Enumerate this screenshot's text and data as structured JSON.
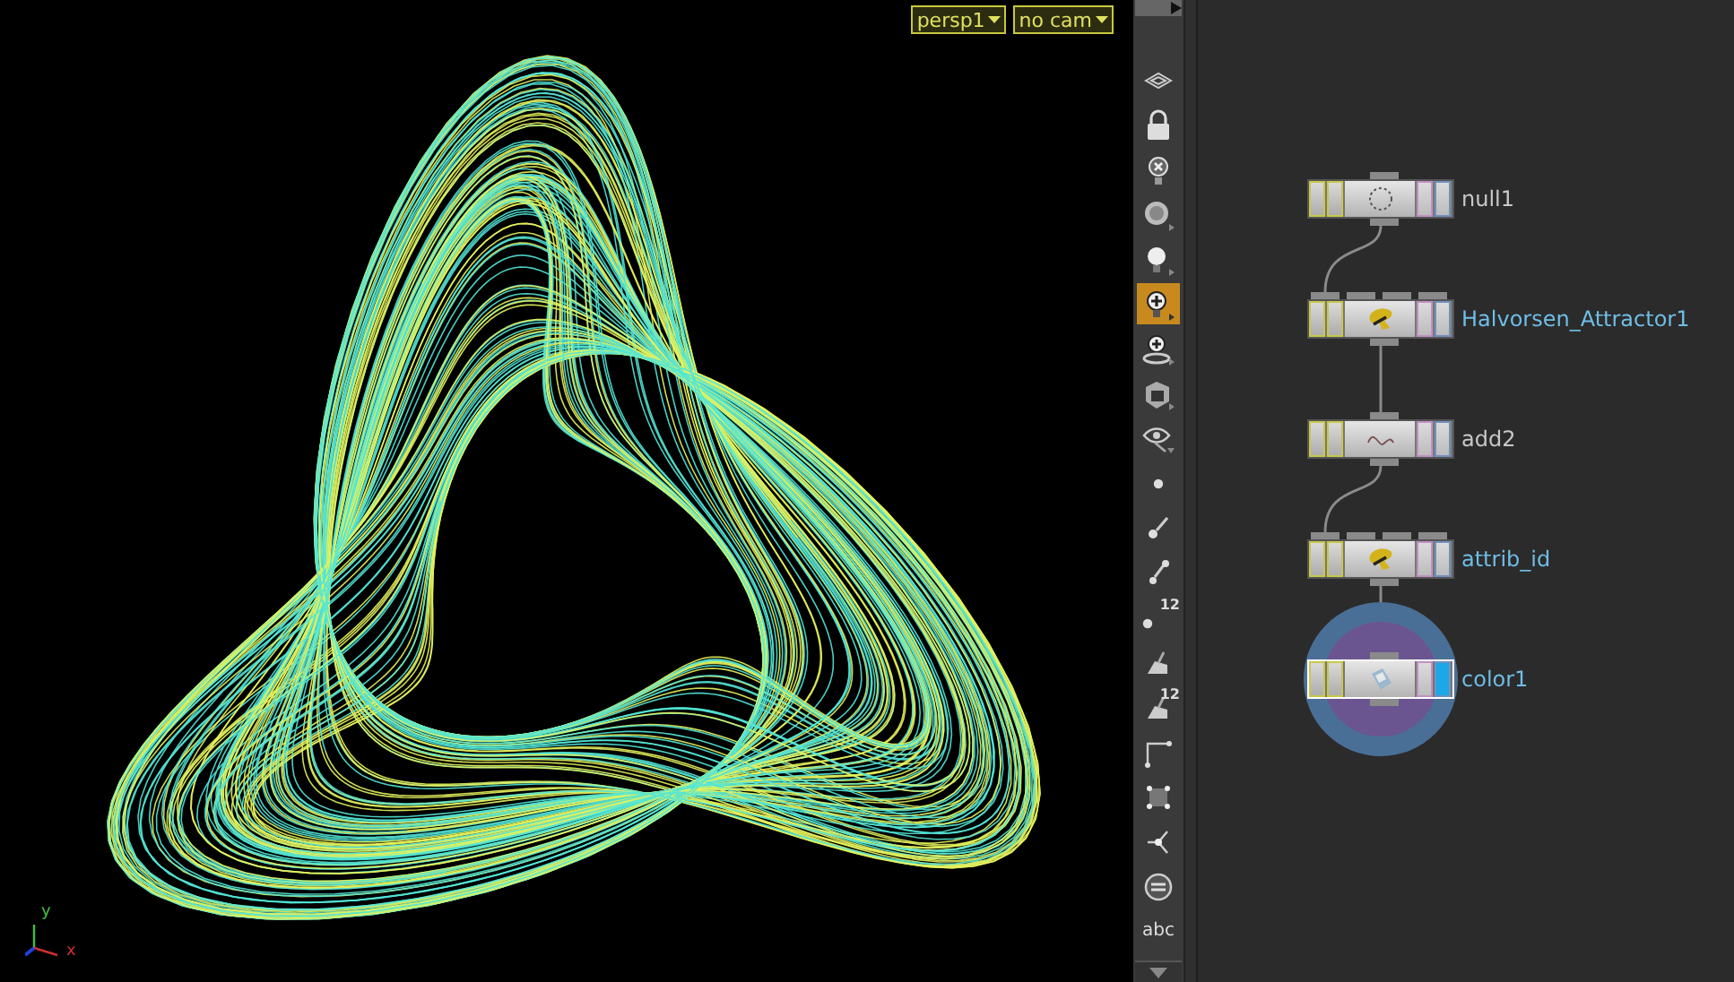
{
  "viewport": {
    "camera_menus": [
      {
        "label": "persp1"
      },
      {
        "label": "no cam"
      }
    ],
    "axis_labels": [
      {
        "label": "y"
      },
      {
        "label": "x"
      }
    ]
  },
  "toolbar": {
    "tools": [
      {
        "kind": "view",
        "selected": false
      },
      {
        "kind": "lock",
        "selected": false
      },
      {
        "kind": "ghost",
        "selected": false
      },
      {
        "kind": "shading",
        "selected": false
      },
      {
        "kind": "light",
        "selected": false
      },
      {
        "kind": "light-add",
        "selected": true
      },
      {
        "kind": "camera-light",
        "selected": false
      },
      {
        "kind": "cube",
        "selected": false
      },
      {
        "kind": "eye",
        "selected": false
      },
      {
        "kind": "point",
        "selected": false
      },
      {
        "kind": "brush",
        "selected": false
      },
      {
        "kind": "pin",
        "selected": false
      },
      {
        "kind": "point-numbers",
        "selected": false,
        "label": "12"
      },
      {
        "kind": "prim",
        "selected": false
      },
      {
        "kind": "prim-numbers",
        "selected": false,
        "label": "12"
      },
      {
        "kind": "edge",
        "selected": false
      },
      {
        "kind": "grid",
        "selected": false
      },
      {
        "kind": "vertex",
        "selected": false
      },
      {
        "kind": "circle",
        "selected": false
      },
      {
        "kind": "text",
        "selected": false,
        "label": "abc"
      }
    ]
  },
  "network": {
    "nodes": [
      {
        "name": "null1",
        "kind": "null",
        "color": "#c8c8c8",
        "selected": false,
        "display_flag": false
      },
      {
        "name": "Halvorsen_Attractor1",
        "kind": "digital-asset",
        "color": "#6fbde6",
        "selected": false,
        "display_flag": false
      },
      {
        "name": "add2",
        "kind": "add",
        "color": "#c8c8c8",
        "selected": false,
        "display_flag": false
      },
      {
        "name": "attrib_id",
        "kind": "digital-asset",
        "color": "#6fbde6",
        "selected": false,
        "display_flag": false
      },
      {
        "name": "color1",
        "kind": "color",
        "color": "#6fbde6",
        "selected": true,
        "display_flag": true
      }
    ]
  }
}
